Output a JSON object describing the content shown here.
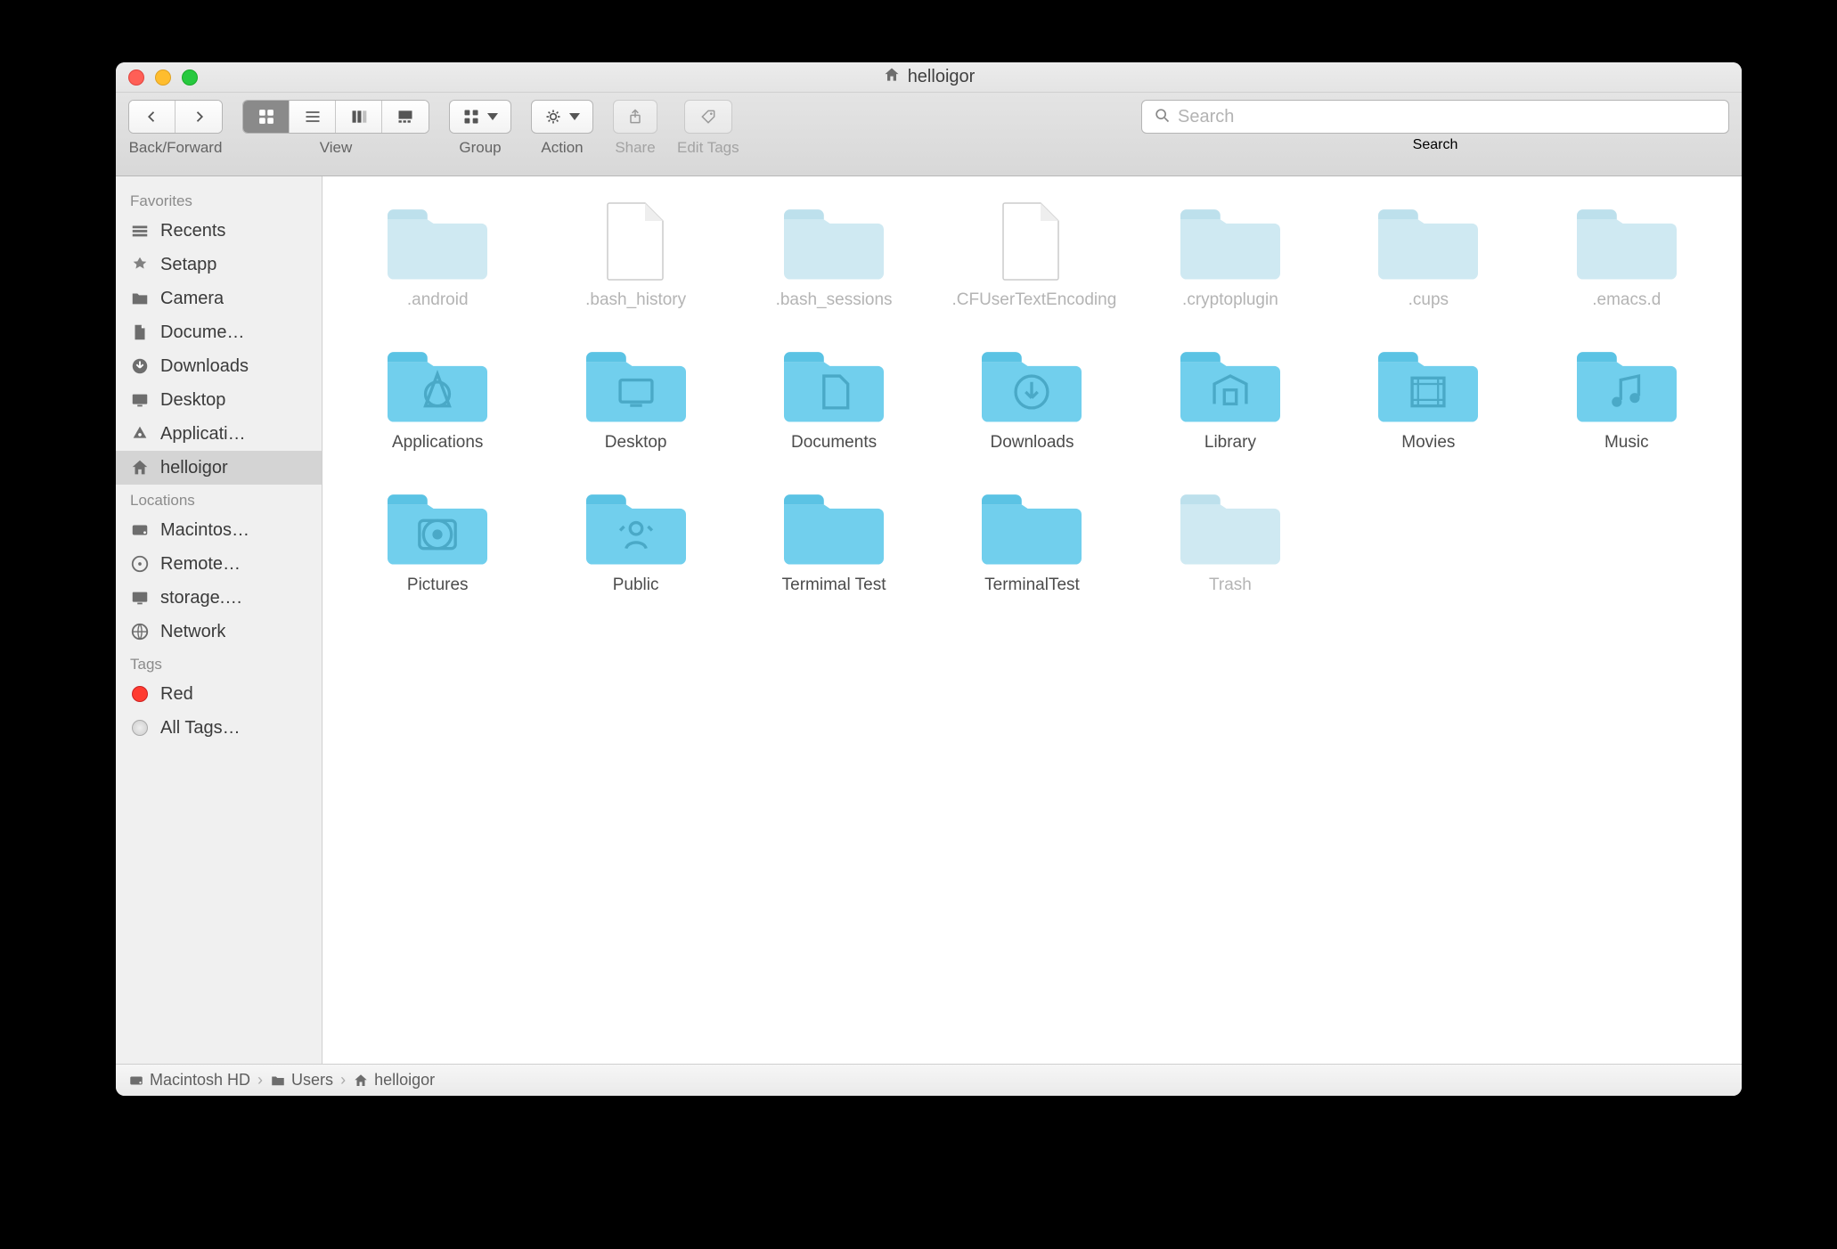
{
  "window": {
    "title": "helloigor"
  },
  "toolbar": {
    "back_forward_label": "Back/Forward",
    "view_label": "View",
    "group_label": "Group",
    "action_label": "Action",
    "share_label": "Share",
    "edit_tags_label": "Edit Tags",
    "search_label": "Search",
    "search_placeholder": "Search"
  },
  "sidebar": {
    "sections": [
      {
        "heading": "Favorites",
        "items": [
          {
            "label": "Recents",
            "icon": "recents"
          },
          {
            "label": "Setapp",
            "icon": "setapp"
          },
          {
            "label": "Camera",
            "icon": "folder"
          },
          {
            "label": "Docume…",
            "icon": "documents"
          },
          {
            "label": "Downloads",
            "icon": "downloads"
          },
          {
            "label": "Desktop",
            "icon": "desktop"
          },
          {
            "label": "Applicati…",
            "icon": "applications"
          },
          {
            "label": "helloigor",
            "icon": "home",
            "selected": true
          }
        ]
      },
      {
        "heading": "Locations",
        "items": [
          {
            "label": "Macintos…",
            "icon": "hdd"
          },
          {
            "label": "Remote…",
            "icon": "remote-disc"
          },
          {
            "label": "storage.…",
            "icon": "monitor"
          },
          {
            "label": "Network",
            "icon": "network"
          }
        ]
      },
      {
        "heading": "Tags",
        "items": [
          {
            "label": "Red",
            "icon": "tag-red"
          },
          {
            "label": "All Tags…",
            "icon": "tag-all"
          }
        ]
      }
    ]
  },
  "items": [
    {
      "label": ".android",
      "type": "folder-hidden"
    },
    {
      "label": ".bash_history",
      "type": "file-hidden"
    },
    {
      "label": ".bash_sessions",
      "type": "folder-hidden"
    },
    {
      "label": ".CFUserTextEncoding",
      "type": "file-hidden"
    },
    {
      "label": ".cryptoplugin",
      "type": "folder-hidden"
    },
    {
      "label": ".cups",
      "type": "folder-hidden"
    },
    {
      "label": ".emacs.d",
      "type": "folder-hidden"
    },
    {
      "label": "Applications",
      "type": "folder",
      "glyph": "applications"
    },
    {
      "label": "Desktop",
      "type": "folder",
      "glyph": "desktop"
    },
    {
      "label": "Documents",
      "type": "folder",
      "glyph": "documents"
    },
    {
      "label": "Downloads",
      "type": "folder",
      "glyph": "downloads"
    },
    {
      "label": "Library",
      "type": "folder",
      "glyph": "library"
    },
    {
      "label": "Movies",
      "type": "folder",
      "glyph": "movies"
    },
    {
      "label": "Music",
      "type": "folder",
      "glyph": "music"
    },
    {
      "label": "Pictures",
      "type": "folder",
      "glyph": "pictures"
    },
    {
      "label": "Public",
      "type": "folder",
      "glyph": "public"
    },
    {
      "label": "Termimal Test",
      "type": "folder"
    },
    {
      "label": "TerminalTest",
      "type": "folder"
    },
    {
      "label": "Trash",
      "type": "folder-hidden"
    }
  ],
  "pathbar": [
    {
      "label": "Macintosh HD",
      "icon": "hdd"
    },
    {
      "label": "Users",
      "icon": "minifolder"
    },
    {
      "label": "helloigor",
      "icon": "home"
    }
  ]
}
